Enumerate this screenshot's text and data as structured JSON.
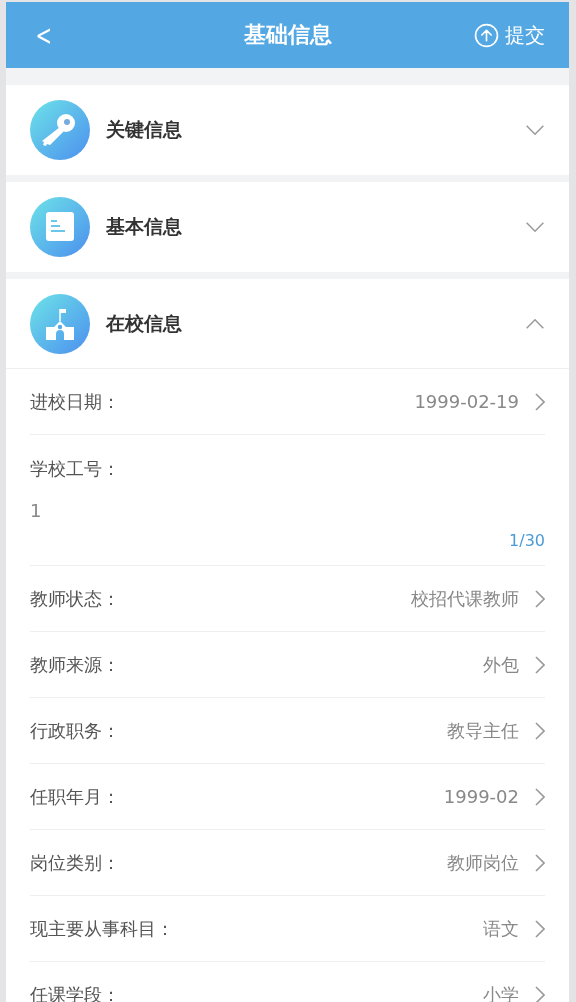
{
  "header": {
    "back": "<",
    "title": "基础信息",
    "submit": "提交"
  },
  "sections": [
    {
      "kind": "key",
      "title": "关键信息",
      "expanded": false
    },
    {
      "kind": "document",
      "title": "基本信息",
      "expanded": false
    },
    {
      "kind": "school",
      "title": "在校信息",
      "expanded": true,
      "fields": [
        {
          "kind": "select",
          "label": "进校日期：",
          "value": "1999-02-19"
        },
        {
          "kind": "text",
          "label": "学校工号：",
          "value": "1",
          "counter": "1/30"
        },
        {
          "kind": "select",
          "label": "教师状态：",
          "value": "校招代课教师"
        },
        {
          "kind": "select",
          "label": "教师来源：",
          "value": "外包"
        },
        {
          "kind": "select",
          "label": "行政职务：",
          "value": "教导主任"
        },
        {
          "kind": "select",
          "label": "任职年月：",
          "value": "1999-02"
        },
        {
          "kind": "select",
          "label": "岗位类别：",
          "value": "教师岗位"
        },
        {
          "kind": "select",
          "label": "现主要从事科目：",
          "value": "语文"
        },
        {
          "kind": "select",
          "label": "任课学段：",
          "value": "小学"
        }
      ]
    }
  ]
}
